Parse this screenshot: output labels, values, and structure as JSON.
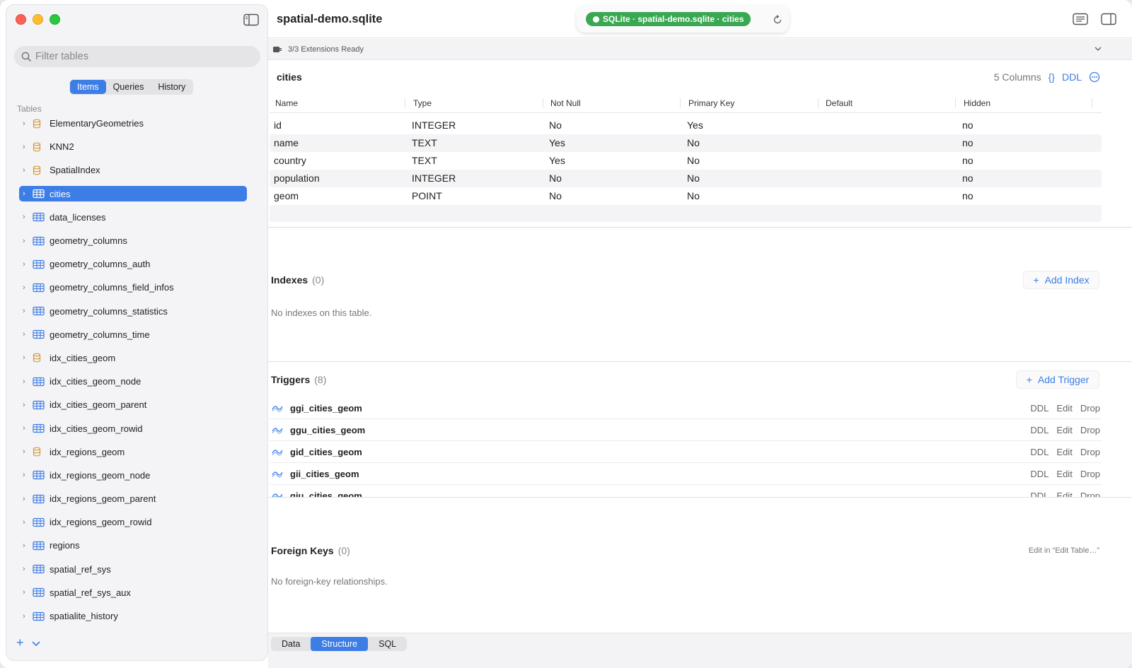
{
  "titlebar": {
    "document": "spatial-demo.sqlite",
    "connection_pill": "SQLite · spatial-demo.sqlite · cities",
    "pill_color": "#3aa853"
  },
  "sidebar": {
    "filter_placeholder": "Filter tables",
    "segments": [
      "Items",
      "Queries",
      "History"
    ],
    "active_segment": "Items",
    "section_label": "Tables",
    "tables": [
      {
        "name": "ElementaryGeometries",
        "icon": "database-icon"
      },
      {
        "name": "KNN2",
        "icon": "database-icon"
      },
      {
        "name": "SpatialIndex",
        "icon": "database-icon"
      },
      {
        "name": "cities",
        "icon": "table-icon",
        "selected": true
      },
      {
        "name": "data_licenses",
        "icon": "table-icon"
      },
      {
        "name": "geometry_columns",
        "icon": "table-icon"
      },
      {
        "name": "geometry_columns_auth",
        "icon": "table-icon"
      },
      {
        "name": "geometry_columns_field_infos",
        "icon": "table-icon"
      },
      {
        "name": "geometry_columns_statistics",
        "icon": "table-icon"
      },
      {
        "name": "geometry_columns_time",
        "icon": "table-icon"
      },
      {
        "name": "idx_cities_geom",
        "icon": "database-icon"
      },
      {
        "name": "idx_cities_geom_node",
        "icon": "table-icon"
      },
      {
        "name": "idx_cities_geom_parent",
        "icon": "table-icon"
      },
      {
        "name": "idx_cities_geom_rowid",
        "icon": "table-icon"
      },
      {
        "name": "idx_regions_geom",
        "icon": "database-icon"
      },
      {
        "name": "idx_regions_geom_node",
        "icon": "table-icon"
      },
      {
        "name": "idx_regions_geom_parent",
        "icon": "table-icon"
      },
      {
        "name": "idx_regions_geom_rowid",
        "icon": "table-icon"
      },
      {
        "name": "regions",
        "icon": "table-icon"
      },
      {
        "name": "spatial_ref_sys",
        "icon": "table-icon"
      },
      {
        "name": "spatial_ref_sys_aux",
        "icon": "table-icon"
      },
      {
        "name": "spatialite_history",
        "icon": "table-icon"
      }
    ]
  },
  "extensions": {
    "status": "3/3 Extensions Ready"
  },
  "columns_section": {
    "table_name": "cities",
    "count_label": "5 Columns",
    "json_label": "{}",
    "ddl_label": "DDL",
    "headers": [
      "Name",
      "Type",
      "Not Null",
      "Primary Key",
      "Default",
      "Hidden"
    ],
    "rows": [
      [
        "id",
        "INTEGER",
        "No",
        "Yes",
        "",
        "no"
      ],
      [
        "name",
        "TEXT",
        "Yes",
        "No",
        "",
        "no"
      ],
      [
        "country",
        "TEXT",
        "Yes",
        "No",
        "",
        "no"
      ],
      [
        "population",
        "INTEGER",
        "No",
        "No",
        "",
        "no"
      ],
      [
        "geom",
        "POINT",
        "No",
        "No",
        "",
        "no"
      ]
    ]
  },
  "indexes": {
    "title": "Indexes",
    "count": "(0)",
    "add_label": "Add Index",
    "empty": "No indexes on this table."
  },
  "triggers": {
    "title": "Triggers",
    "count": "(8)",
    "add_label": "Add Trigger",
    "items": [
      "ggi_cities_geom",
      "ggu_cities_geom",
      "gid_cities_geom",
      "gii_cities_geom",
      "giu_cities_geom"
    ],
    "actions": [
      "DDL",
      "Edit",
      "Drop"
    ]
  },
  "foreign_keys": {
    "title": "Foreign Keys",
    "count": "(0)",
    "note": "Edit in “Edit Table…”",
    "empty": "No foreign-key relationships."
  },
  "bottom_tabs": {
    "tabs": [
      "Data",
      "Structure",
      "SQL"
    ],
    "active": "Structure"
  },
  "colors": {
    "accent": "#3d7de6",
    "db_icon": "#d49a3a"
  }
}
